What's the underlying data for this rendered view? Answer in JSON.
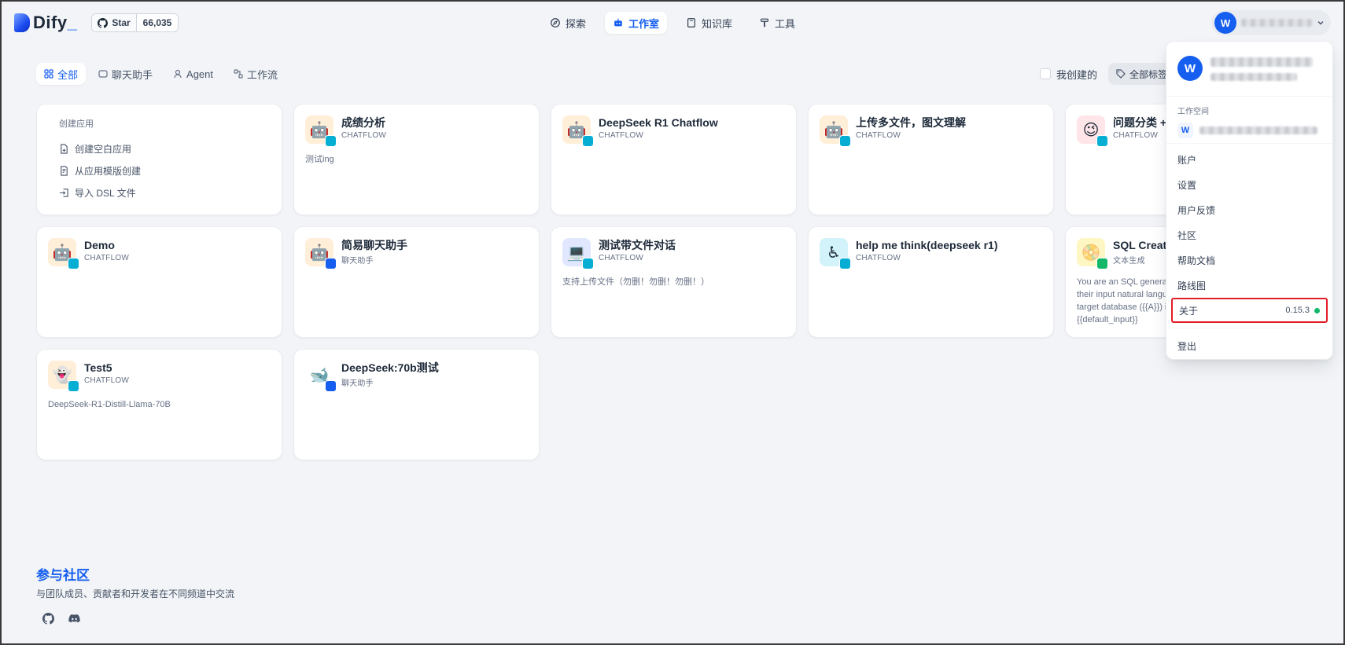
{
  "header": {
    "logo_text": "Dify",
    "logo_underscore": "_",
    "github": {
      "star_label": "Star",
      "star_count": "66,035"
    },
    "nav": [
      {
        "label": "探索",
        "icon": "compass-icon"
      },
      {
        "label": "工作室",
        "icon": "robot-icon",
        "active": true
      },
      {
        "label": "知识库",
        "icon": "book-icon"
      },
      {
        "label": "工具",
        "icon": "hammer-icon"
      }
    ],
    "user_initial": "W"
  },
  "tabs": [
    {
      "label": "全部",
      "icon": "grid-icon",
      "active": true
    },
    {
      "label": "聊天助手",
      "icon": "chat-icon"
    },
    {
      "label": "Agent",
      "icon": "agent-icon"
    },
    {
      "label": "工作流",
      "icon": "workflow-icon"
    }
  ],
  "filters": {
    "mine_label": "我创建的",
    "tags_label": "全部标签"
  },
  "create_card": {
    "title": "创建应用",
    "items": [
      "创建空白应用",
      "从应用模版创建",
      "导入 DSL 文件"
    ]
  },
  "apps": [
    {
      "title": "成绩分析",
      "type": "CHATFLOW",
      "desc": "测试ing",
      "icon": "🤖",
      "icon_bg": "#ffeed8",
      "badge": "teal"
    },
    {
      "title": "DeepSeek R1 Chatflow",
      "type": "CHATFLOW",
      "desc": "",
      "icon": "🤖",
      "icon_bg": "#ffeed8",
      "badge": "teal"
    },
    {
      "title": "上传多文件，图文理解",
      "type": "CHATFLOW",
      "desc": "",
      "icon": "🤖",
      "icon_bg": "#ffeed8",
      "badge": "teal"
    },
    {
      "title": "问题分类 + 知识库",
      "type": "CHATFLOW",
      "desc": "",
      "icon": "😉",
      "icon_bg": "#ffe4e8",
      "badge": "teal"
    },
    {
      "title": "Demo",
      "type": "CHATFLOW",
      "desc": "",
      "icon": "🤖",
      "icon_bg": "#ffeed8",
      "badge": "teal"
    },
    {
      "title": "简易聊天助手",
      "type": "聊天助手",
      "desc": "",
      "icon": "🤖",
      "icon_bg": "#ffeed8",
      "badge": "blue"
    },
    {
      "title": "测试带文件对话",
      "type": "CHATFLOW",
      "desc": "支持上传文件（勿删！勿删！勿删！）",
      "icon": "💻",
      "icon_bg": "#e0e7ff",
      "badge": "teal"
    },
    {
      "title": "help me think(deepseek r1)",
      "type": "CHATFLOW",
      "desc": "",
      "icon": "♿",
      "icon_bg": "#d1f3f9",
      "badge": "teal"
    },
    {
      "title": "SQL Creator",
      "type": "文本生成",
      "desc": "You are an SQL generator that will help users translate their input natural language query requirements and target database ({{A}}) into target SQL statements. {{default_input}}",
      "icon": "📀",
      "icon_bg": "#fef7c3",
      "badge": "green"
    },
    {
      "title": "Test5",
      "type": "CHATFLOW",
      "desc": "DeepSeek-R1-Distill-Llama-70B",
      "icon": "👻",
      "icon_bg": "#ffeed8",
      "badge": "teal"
    },
    {
      "title": "DeepSeek:70b测试",
      "type": "聊天助手",
      "desc": "",
      "icon": "🐋",
      "icon_bg": "#ffffff",
      "badge": "blue"
    }
  ],
  "community": {
    "title": "参与社区",
    "subtitle": "与团队成员、贡献者和开发者在不同频道中交流",
    "icons": [
      "github-icon",
      "discord-icon"
    ]
  },
  "dropdown": {
    "workspace_title": "工作空间",
    "workspace_initial": "W",
    "menu": [
      "账户",
      "设置",
      "用户反馈",
      "社区",
      "帮助文档",
      "路线图"
    ],
    "about_label": "关于",
    "version": "0.15.3",
    "logout_label": "登出"
  },
  "colors": {
    "accent": "#155eef",
    "highlight_border": "#e11d26",
    "status_ok": "#12b76a"
  }
}
